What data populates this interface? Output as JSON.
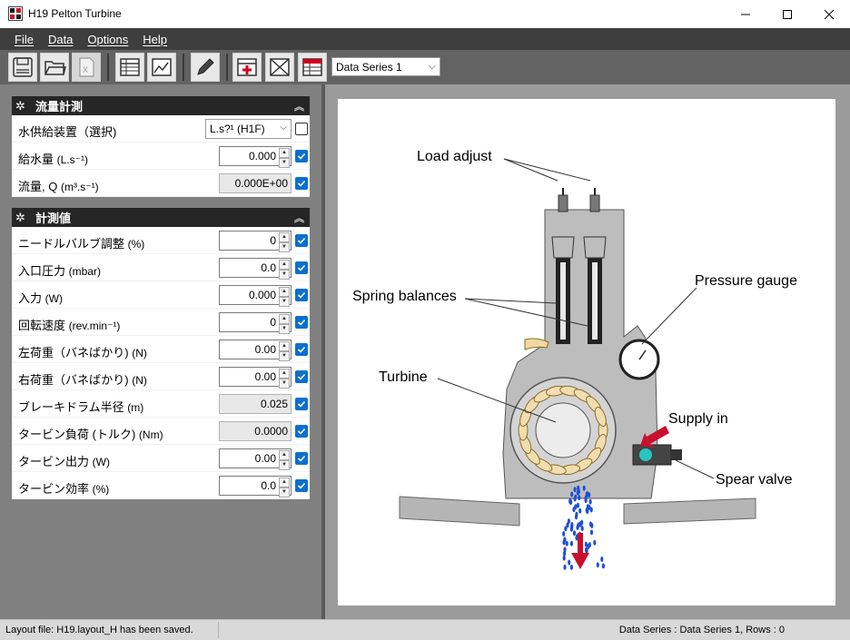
{
  "window": {
    "title": "H19 Pelton Turbine"
  },
  "menu": {
    "file": "File",
    "data": "Data",
    "options": "Options",
    "help": "Help"
  },
  "toolbar": {
    "series_select": "Data Series 1"
  },
  "sections": {
    "flow": {
      "title": "流量計測",
      "rows": [
        {
          "label": "水供給装置（選択)",
          "unit": "",
          "value": "L.s?¹ (H1F)"
        },
        {
          "label": "給水量",
          "unit": "(L.s⁻¹)",
          "value": "0.000"
        },
        {
          "label": "流量, Q",
          "unit": "(m³.s⁻¹)",
          "value": "0.000E+00"
        }
      ]
    },
    "measure": {
      "title": "計測値",
      "rows": [
        {
          "label": "ニードルバルブ調整",
          "unit": "(%)",
          "value": "0"
        },
        {
          "label": "入口圧力",
          "unit": "(mbar)",
          "value": "0.0"
        },
        {
          "label": "入力",
          "unit": "(W)",
          "value": "0.000"
        },
        {
          "label": "回転速度",
          "unit": "(rev.min⁻¹)",
          "value": "0"
        },
        {
          "label": "左荷重（バネばかり)",
          "unit": "(N)",
          "value": "0.00"
        },
        {
          "label": "右荷重（バネばかり)",
          "unit": "(N)",
          "value": "0.00"
        },
        {
          "label": "ブレーキドラム半径",
          "unit": "(m)",
          "value": "0.025"
        },
        {
          "label": "タービン負荷 (トルク)",
          "unit": "(Nm)",
          "value": "0.0000"
        },
        {
          "label": "タービン出力",
          "unit": "(W)",
          "value": "0.00"
        },
        {
          "label": "タービン効率",
          "unit": "(%)",
          "value": "0.0"
        }
      ]
    }
  },
  "diagram": {
    "load_adjust": "Load adjust",
    "spring_balances": "Spring balances",
    "pressure_gauge": "Pressure gauge",
    "turbine": "Turbine",
    "supply_in": "Supply in",
    "spear_valve": "Spear valve"
  },
  "status": {
    "left": "Layout file: H19.layout_H has been saved.",
    "right": "Data Series : Data Series 1,  Rows : 0"
  }
}
